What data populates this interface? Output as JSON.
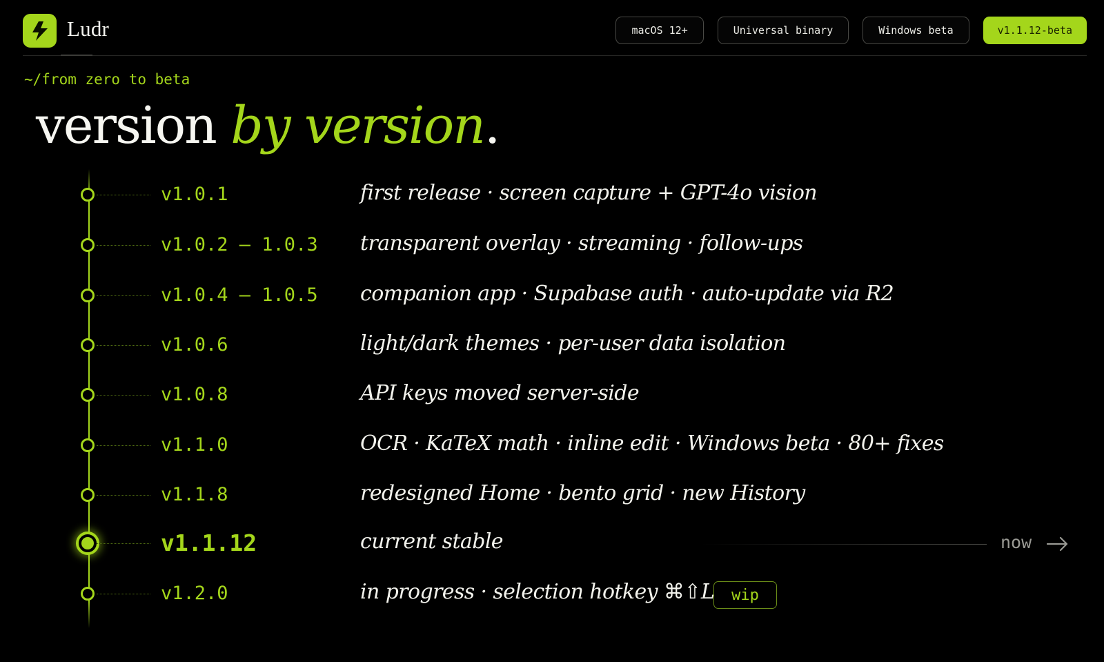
{
  "brand": {
    "name": "Ludr",
    "logo_icon": "lightning-bolt-icon"
  },
  "header": {
    "chips": [
      {
        "label": "macOS 12+"
      },
      {
        "label": "Universal binary"
      },
      {
        "label": "Windows beta"
      },
      {
        "label": "v1.1.12-beta",
        "accent": true
      }
    ]
  },
  "hero": {
    "eyebrow": "~/from zero to beta",
    "title_plain": "version ",
    "title_highlight": "by version",
    "title_end": "."
  },
  "timeline": {
    "rows": [
      {
        "version": "v1.0.1",
        "description": "first release · screen capture + GPT-4o vision"
      },
      {
        "version": "v1.0.2 – 1.0.3",
        "description": "transparent overlay · streaming · follow-ups"
      },
      {
        "version": "v1.0.4 – 1.0.5",
        "description": "companion app · Supabase auth · auto-update via R2"
      },
      {
        "version": "v1.0.6",
        "description": "light/dark themes · per-user data isolation"
      },
      {
        "version": "v1.0.8",
        "description": "API keys moved server-side"
      },
      {
        "version": "v1.1.0",
        "description": "OCR · KaTeX math · inline edit · Windows beta · 80+ fixes"
      },
      {
        "version": "v1.1.8",
        "description": "redesigned Home · bento grid · new History"
      },
      {
        "version": "v1.1.12",
        "description": "current stable",
        "current": true,
        "marker": "now"
      },
      {
        "version": "v1.2.0",
        "description": "in progress · selection hotkey ⌘⇧L",
        "badge": "wip"
      }
    ]
  },
  "colors": {
    "accent": "#a4d61b",
    "background": "#000000",
    "text": "#f2f2ec"
  }
}
